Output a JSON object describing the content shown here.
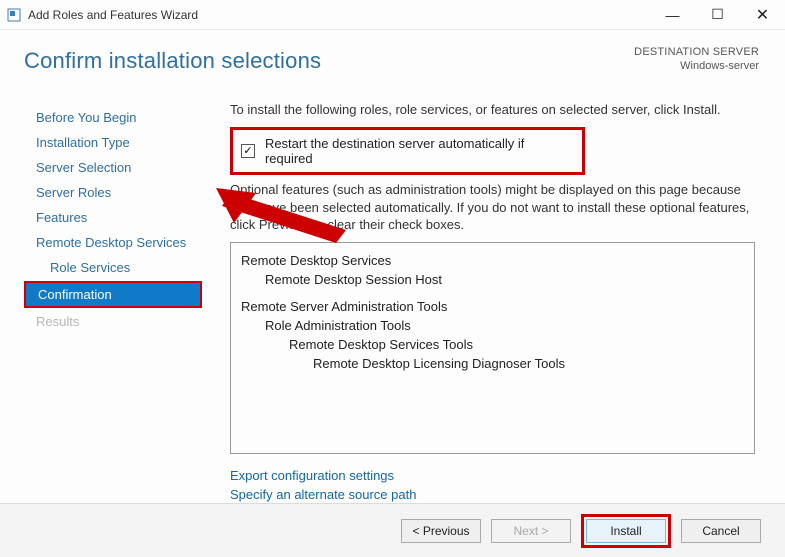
{
  "window": {
    "title": "Add Roles and Features Wizard"
  },
  "header": {
    "heading": "Confirm installation selections",
    "dest_label": "DESTINATION SERVER",
    "dest_value": "Windows-server"
  },
  "nav": {
    "items": [
      {
        "label": "Before You Begin"
      },
      {
        "label": "Installation Type"
      },
      {
        "label": "Server Selection"
      },
      {
        "label": "Server Roles"
      },
      {
        "label": "Features"
      },
      {
        "label": "Remote Desktop Services"
      },
      {
        "label": "Role Services"
      },
      {
        "label": "Confirmation"
      },
      {
        "label": "Results"
      }
    ]
  },
  "main": {
    "intro": "To install the following roles, role services, or features on selected server, click Install.",
    "restart_label": "Restart the destination server automatically if required",
    "restart_check": "✓",
    "optional_text": "Optional features (such as administration tools) might be displayed on this page because they have been selected automatically. If you do not want to install these optional features, click Previous to clear their check boxes.",
    "features": {
      "g1": {
        "l0": "Remote Desktop Services",
        "l1": "Remote Desktop Session Host"
      },
      "g2": {
        "l0": "Remote Server Administration Tools",
        "l1": "Role Administration Tools",
        "l2": "Remote Desktop Services Tools",
        "l3": "Remote Desktop Licensing Diagnoser Tools"
      }
    },
    "links": {
      "export": "Export configuration settings",
      "alt_source": "Specify an alternate source path"
    }
  },
  "footer": {
    "previous": "< Previous",
    "next": "Next >",
    "install": "Install",
    "cancel": "Cancel"
  }
}
